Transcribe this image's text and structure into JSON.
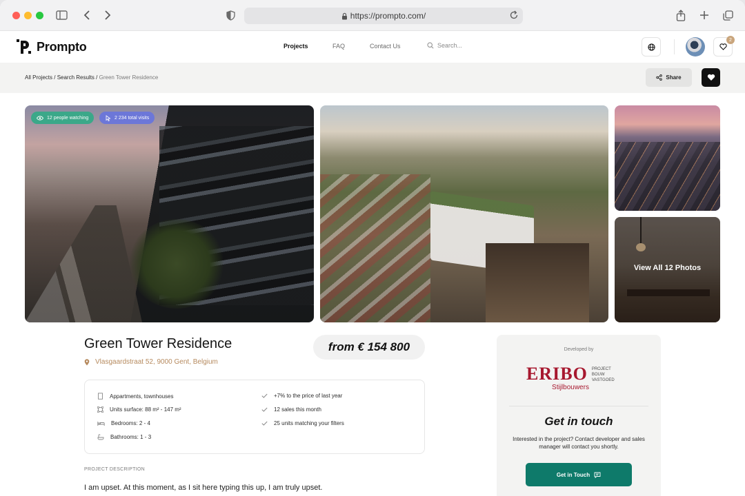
{
  "browser": {
    "url": "https://prompto.com/"
  },
  "header": {
    "logo_text": "Prompto",
    "nav": [
      {
        "label": "Projects",
        "active": true
      },
      {
        "label": "FAQ",
        "active": false
      },
      {
        "label": "Contact Us",
        "active": false
      }
    ],
    "search_placeholder": "Search...",
    "favorites_count": "2",
    "icons": [
      "globe-icon",
      "avatar",
      "heart-icon"
    ]
  },
  "breadcrumb": {
    "items": [
      "All Projects",
      "Search Results"
    ],
    "separator": " / ",
    "current": "Green Tower Residence"
  },
  "actions": {
    "share_label": "Share"
  },
  "gallery": {
    "watching_label": "12 people watching",
    "visits_label": "2 234 total visits",
    "view_all_label": "View All 12 Photos",
    "pill_colors": {
      "watching": "#3ba889",
      "visits": "#6c77d8"
    }
  },
  "project": {
    "title": "Green Tower Residence",
    "address": "Vlasgaardstraat 52, 9000 Gent, Belgium",
    "price": "from € 154 800"
  },
  "features": {
    "left": [
      {
        "icon": "building-icon",
        "text": "Appartments, townhouses"
      },
      {
        "icon": "surface-icon",
        "text": "Units surface: 88 m² - 147 m²"
      },
      {
        "icon": "bed-icon",
        "text": "Bedrooms: 2 - 4"
      },
      {
        "icon": "bath-icon",
        "text": "Bathrooms: 1 - 3"
      }
    ],
    "right": [
      {
        "icon": "check-icon",
        "text": "+7% to the price of last year"
      },
      {
        "icon": "check-icon",
        "text": "12 sales this month"
      },
      {
        "icon": "check-icon",
        "text": "25 units matching your filters"
      }
    ]
  },
  "description": {
    "label": "PROJECT DESCRIPTION",
    "text": "I am upset. At this moment, as I sit here typing this up, I am truly upset."
  },
  "developer": {
    "label": "Developed by",
    "logo_name": "ERIBO",
    "logo_sub": "Stijlbouwers",
    "logo_side": [
      "PROJECT",
      "BOUW",
      "VASTGOED"
    ],
    "get_in_touch_title": "Get in touch",
    "get_in_touch_text": "Interested in the project? Contact developer and sales manager will contact you shortly.",
    "button_label": "Get in Touch",
    "brand_color": "#a7182f",
    "button_color": "#0e7a6a"
  }
}
